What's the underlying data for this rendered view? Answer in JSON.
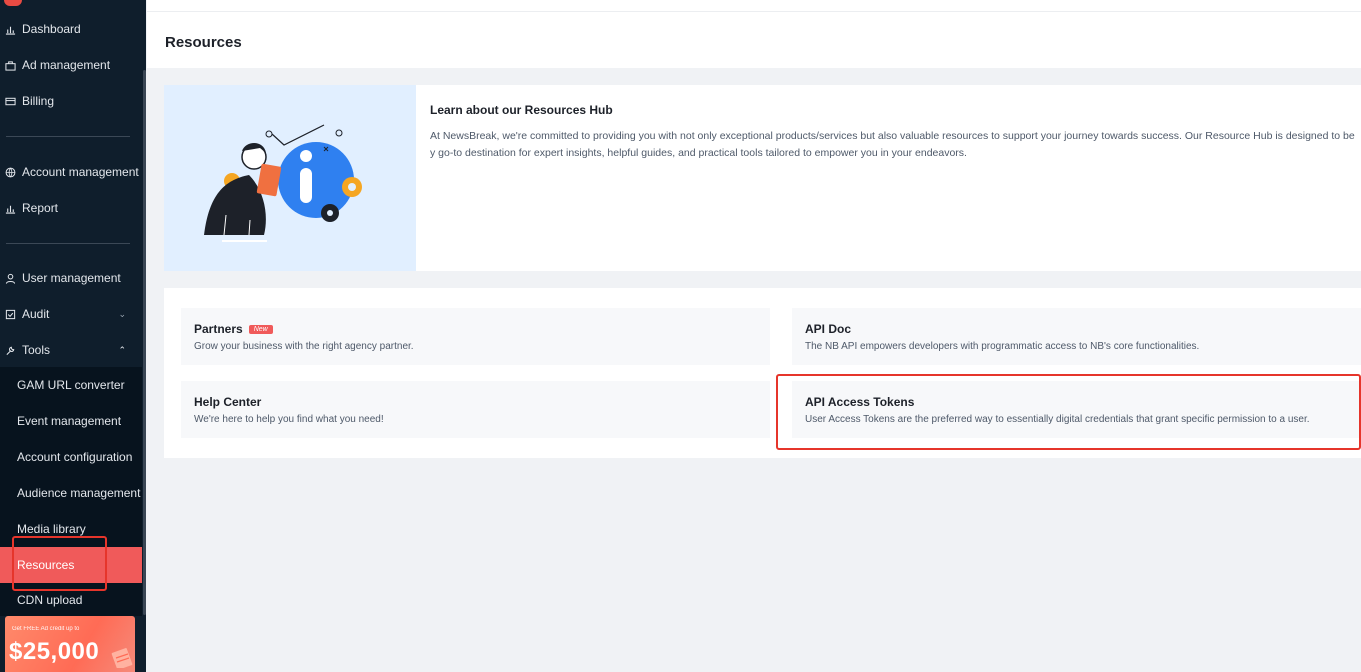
{
  "sidebar": {
    "items": [
      {
        "label": "Dashboard",
        "icon": "bar-chart-icon"
      },
      {
        "label": "Ad management",
        "icon": "briefcase-icon"
      },
      {
        "label": "Billing",
        "icon": "card-icon"
      },
      {
        "label": "Account management",
        "icon": "globe-icon"
      },
      {
        "label": "Report",
        "icon": "bar-chart-icon"
      },
      {
        "label": "User management",
        "icon": "user-icon"
      },
      {
        "label": "Audit",
        "icon": "audit-icon"
      },
      {
        "label": "Tools",
        "icon": "wrench-icon"
      }
    ],
    "audit_chevron": "⌄",
    "tools_chevron": "⌃",
    "tools_sub": [
      {
        "label": "GAM URL converter"
      },
      {
        "label": "Event management"
      },
      {
        "label": "Account configuration"
      },
      {
        "label": "Audience management"
      },
      {
        "label": "Media library"
      },
      {
        "label": "Resources",
        "active": true
      },
      {
        "label": "CDN upload"
      }
    ],
    "promo": {
      "small": "Get FREE Ad credit up to",
      "big": "$25,000"
    }
  },
  "header": {
    "title": "Resources"
  },
  "hub": {
    "title": "Learn about our Resources Hub",
    "description": "At NewsBreak, we're committed to providing you with not only exceptional products/services but also valuable resources to support your journey towards success. Our Resource Hub is designed to be y go-to destination for expert insights, helpful guides, and practical tools tailored to empower you in your endeavors."
  },
  "resources": [
    {
      "title": "Partners",
      "badge": "New",
      "description": "Grow your business with the right agency partner."
    },
    {
      "title": "API Doc",
      "description": "The NB API empowers developers with programmatic access to NB's core functionalities."
    },
    {
      "title": "Help Center",
      "description": "We're here to help you find what you need!"
    },
    {
      "title": "API Access Tokens",
      "description": "User Access Tokens are the preferred way to essentially digital credentials that grant specific permission to a user."
    }
  ],
  "colors": {
    "sidebar_bg": "#0f1e2c",
    "active": "#f05a5a",
    "highlight": "#e6352b",
    "accent_blue": "#3b82f6"
  }
}
